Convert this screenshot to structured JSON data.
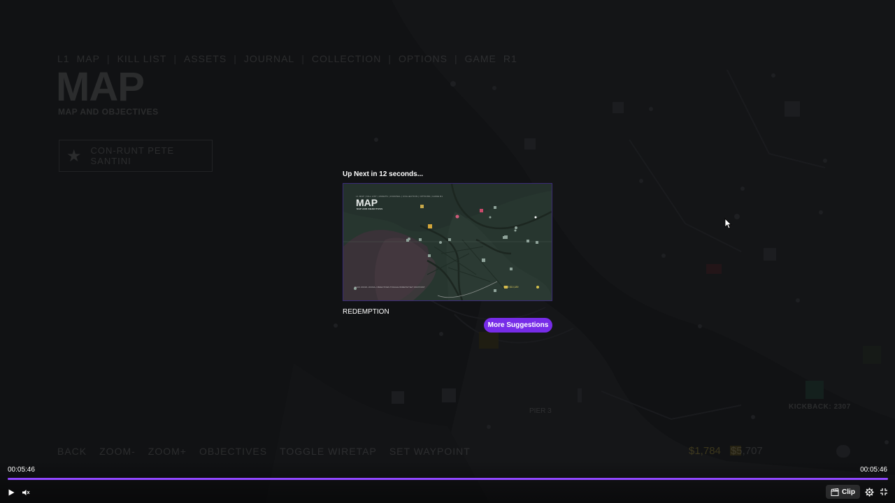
{
  "game": {
    "nav_items": [
      "L1",
      "MAP",
      "|",
      "KILL LIST",
      "|",
      "ASSETS",
      "|",
      "JOURNAL",
      "|",
      "COLLECTION",
      "|",
      "OPTIONS",
      "|",
      "GAME",
      "R1"
    ],
    "title": "MAP",
    "subtitle": "MAP AND OBJECTIVES",
    "objective": "CON-RUNT PETE SANTINI",
    "hints": [
      "BACK",
      "ZOOM-",
      "ZOOM+",
      "OBJECTIVES",
      "TOGGLE WIRETAP",
      "SET WAYPOINT"
    ],
    "kickback": "KICKBACK: 2307",
    "cash": "$1,784",
    "money": "$5,707",
    "map_label": "PIER 3"
  },
  "up_next": {
    "heading": "Up Next in 12 seconds...",
    "title": "REDEMPTION",
    "more_button": "More Suggestions",
    "thumbnail": {
      "nav": "L1  MAP  |  KILL LIST  |  ASSETS  |  JOURNAL  |  COLLECTION  |  OPTIONS  |  GAME  R1",
      "title": "MAP",
      "subtitle": "MAP AND OBJECTIVES",
      "hints": "BACK  ZOOM-  ZOOM+  OBJECTIVES  TOGGLE WIRETAP  SET WAYPOINT",
      "stats": "$700   $10,189"
    }
  },
  "player": {
    "time_current": "00:05:46",
    "time_total": "00:05:46",
    "progress": 1.0,
    "clip_label": "Clip",
    "accent_color": "#9147ff",
    "button_color": "#772ce8"
  }
}
